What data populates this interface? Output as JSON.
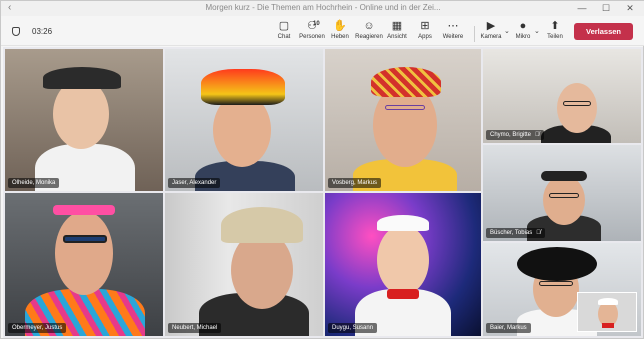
{
  "window": {
    "title": "Morgen kurz - Die Themen am Hochrhein - Online und in der Zei...",
    "minimize": "—",
    "maximize": "☐",
    "close": "✕"
  },
  "toolbar": {
    "timer": "03:26",
    "items": [
      {
        "label": "Chat",
        "icon": "chat-icon",
        "glyph": "💬"
      },
      {
        "label": "Personen",
        "icon": "people-icon",
        "glyph": "👥",
        "badge": "10"
      },
      {
        "label": "Heben",
        "icon": "raise-hand-icon",
        "glyph": "✋"
      },
      {
        "label": "Reagieren",
        "icon": "react-icon",
        "glyph": "☺"
      },
      {
        "label": "Ansicht",
        "icon": "view-icon",
        "glyph": "▦"
      },
      {
        "label": "Apps",
        "icon": "apps-icon",
        "glyph": "⊞"
      },
      {
        "label": "Weitere",
        "icon": "more-icon",
        "glyph": "⋯"
      },
      {
        "label": "Kamera",
        "icon": "camera-icon",
        "glyph": "🎥"
      },
      {
        "label": "Mikro",
        "icon": "microphone-icon",
        "glyph": "🎙"
      },
      {
        "label": "Teilen",
        "icon": "share-icon",
        "glyph": "⬆"
      }
    ],
    "leave_label": "Verlassen",
    "leave_color": "#c4314b"
  },
  "participants": [
    {
      "name": "Olheide, Monika",
      "muted": false,
      "speaking": false
    },
    {
      "name": "Jaser, Alexander",
      "muted": false,
      "speaking": false
    },
    {
      "name": "Vosberg, Markus",
      "muted": false,
      "speaking": true
    },
    {
      "name": "Chymo, Brigitte",
      "muted": true,
      "speaking": false
    },
    {
      "name": "Büscher, Tobias",
      "muted": true,
      "speaking": false
    },
    {
      "name": "Obermeyer, Justus",
      "muted": false,
      "speaking": false
    },
    {
      "name": "Neubert, Michael",
      "muted": false,
      "speaking": false
    },
    {
      "name": "Duygu, Susann",
      "muted": false,
      "speaking": false
    },
    {
      "name": "Baier, Markus",
      "muted": false,
      "speaking": true
    }
  ],
  "colors": {
    "speaking_outline": "#6264a7"
  }
}
